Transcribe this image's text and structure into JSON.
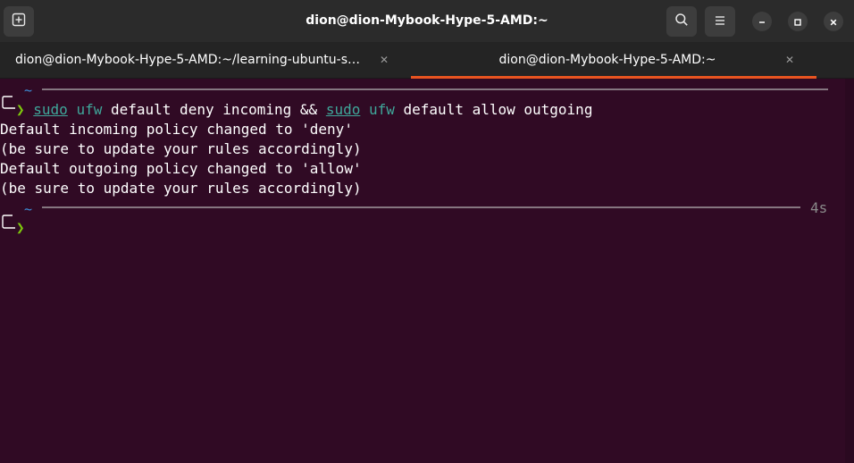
{
  "window": {
    "title": "dion@dion-Mybook-Hype-5-AMD:~"
  },
  "tabs": [
    {
      "label": "dion@dion-Mybook-Hype-5-AMD:~/learning-ubuntu-server",
      "active": false
    },
    {
      "label": "dion@dion-Mybook-Hype-5-AMD:~",
      "active": true
    }
  ],
  "colors": {
    "terminal_bg": "#300a24",
    "active_tab_accent": "#e95420",
    "prompt_arrow": "#7ec90c",
    "command_highlight": "#3fa79a",
    "directory": "#3d8fd9"
  },
  "icons": {
    "new_tab": "new-tab-icon",
    "search": "search-icon",
    "menu": "hamburger-menu-icon",
    "minimize": "minimize-icon",
    "maximize": "maximize-icon",
    "close": "close-icon",
    "tab_close": "tab-close-icon",
    "tabs_dropdown": "chevron-down-icon"
  },
  "terminal": {
    "prompt1": {
      "dir": "~",
      "glyph": "❯",
      "cmd": {
        "sudo1": "sudo",
        "ufw1": "ufw",
        "part1": " default deny incoming && ",
        "sudo2": "sudo",
        "ufw2": "ufw",
        "part2": " default allow outgoing"
      }
    },
    "output": [
      "Default incoming policy changed to 'deny'",
      "(be sure to update your rules accordingly)",
      "Default outgoing policy changed to 'allow'",
      "(be sure to update your rules accordingly)"
    ],
    "prompt2": {
      "dir": "~",
      "glyph": "❯",
      "duration": "4s"
    }
  }
}
